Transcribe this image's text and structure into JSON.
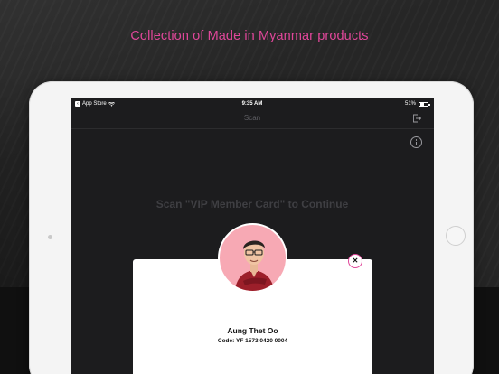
{
  "headline": "Collection of Made in Myanmar products",
  "status_bar": {
    "back_app": "App Store",
    "time": "9:35 AM",
    "battery_text": "51%",
    "battery_level": 0.51
  },
  "nav": {
    "title": "Scan"
  },
  "scan_prompt": "Scan \"VIP Member Card\" to Continue",
  "member": {
    "name": "Aung Thet Oo",
    "code": "Code: YF 1573 0420 0004"
  },
  "colors": {
    "accent": "#e0479a",
    "screen_bg": "#1c1c1e",
    "avatar_bg": "#f7a9b4"
  }
}
